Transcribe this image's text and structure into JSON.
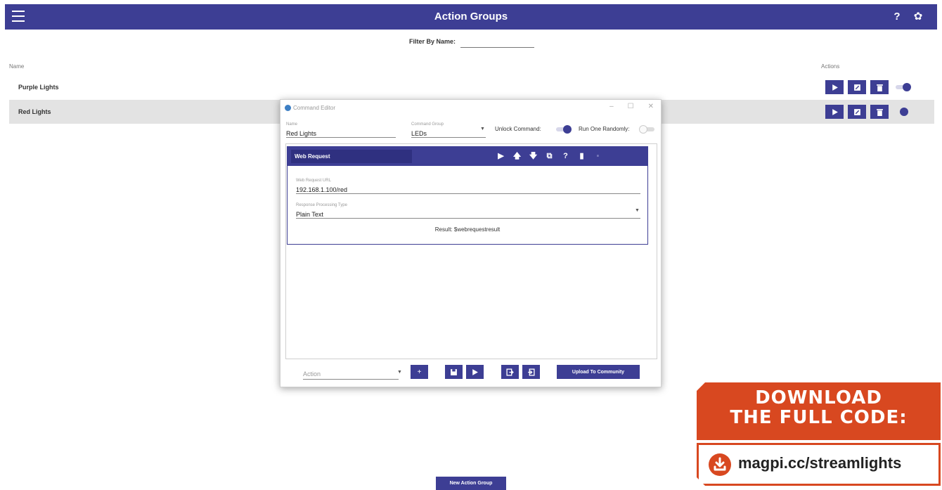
{
  "appbar": {
    "title": "Action Groups",
    "help": "?"
  },
  "filter": {
    "label": "Filter By Name:",
    "value": ""
  },
  "table": {
    "col_name": "Name",
    "col_actions": "Actions",
    "rows": [
      {
        "label": "Purple Lights",
        "enabled": true
      },
      {
        "label": "Red Lights",
        "enabled": true
      }
    ]
  },
  "dialog": {
    "title": "Command Editor",
    "name_label": "Name",
    "name_value": "Red Lights",
    "group_label": "Command Group",
    "group_value": "LEDs",
    "unlock_label": "Unlock Command:",
    "runone_label": "Run One Randomly:",
    "command": {
      "name": "Web Request",
      "url_label": "Web Request URL",
      "url_value": "192.168.1.100/red",
      "proc_label": "Response Processing Type",
      "proc_value": "Plain Text",
      "result": "Result: $webrequestresult"
    },
    "action_placeholder": "Action",
    "upload_label": "Upload To Community"
  },
  "new_group_label": "New Action Group",
  "promo": {
    "line1": "DOWNLOAD",
    "line2": "THE FULL CODE:",
    "url": "magpi.cc/streamlights"
  },
  "colors": {
    "primary": "#3d3e94",
    "promo": "#d84820"
  }
}
